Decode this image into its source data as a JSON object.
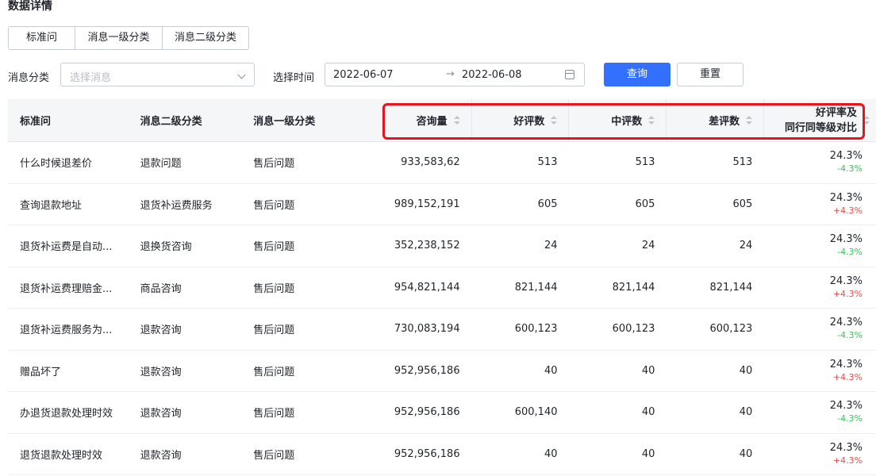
{
  "page": {
    "title": "数据详情"
  },
  "tabs": [
    {
      "label": "标准问"
    },
    {
      "label": "消息一级分类"
    },
    {
      "label": "消息二级分类"
    }
  ],
  "filters": {
    "category_label": "消息分类",
    "category_placeholder": "选择消息",
    "time_label": "选择时间",
    "date_start": "2022-06-07",
    "date_separator": "→",
    "date_end": "2022-06-08",
    "query_button": "查询",
    "reset_button": "重置"
  },
  "colors": {
    "primary": "#3370ff",
    "highlight": "#e8141b",
    "negative_delta": "#34c759",
    "positive_delta": "#f54a45"
  },
  "table": {
    "columns": {
      "standard_question": "标准问",
      "level2": "消息二级分类",
      "level1": "消息一级分类",
      "inquiries": "咨询量",
      "good": "好评数",
      "medium": "中评数",
      "bad": "差评数",
      "rate_line1": "好评率及",
      "rate_line2": "同行同等级对比"
    },
    "rows": [
      {
        "q": "什么时候退差价",
        "l2": "退款问题",
        "l1": "售后问题",
        "inq": "933,583,62",
        "good": "513",
        "medium": "513",
        "bad": "513",
        "rate": "24.3%",
        "delta": "-4.3%",
        "delta_dir": "neg"
      },
      {
        "q": "查询退款地址",
        "l2": "退货补运费服务",
        "l1": "售后问题",
        "inq": "989,152,191",
        "good": "605",
        "medium": "605",
        "bad": "605",
        "rate": "24.3%",
        "delta": "+4.3%",
        "delta_dir": "pos"
      },
      {
        "q": "退货补运费是自动...",
        "l2": "退换货咨询",
        "l1": "售后问题",
        "inq": "352,238,152",
        "good": "24",
        "medium": "24",
        "bad": "24",
        "rate": "24.3%",
        "delta": "-4.3%",
        "delta_dir": "neg"
      },
      {
        "q": "退货补运费理赔金...",
        "l2": "商品咨询",
        "l1": "售后问题",
        "inq": "954,821,144",
        "good": "821,144",
        "medium": "821,144",
        "bad": "821,144",
        "rate": "24.3%",
        "delta": "+4.3%",
        "delta_dir": "pos"
      },
      {
        "q": "退货补运费服务为...",
        "l2": "退款咨询",
        "l1": "售后问题",
        "inq": "730,083,194",
        "good": "600,123",
        "medium": "600,123",
        "bad": "600,123",
        "rate": "24.3%",
        "delta": "-4.3%",
        "delta_dir": "neg"
      },
      {
        "q": "赠品坏了",
        "l2": "退款咨询",
        "l1": "售后问题",
        "inq": "952,956,186",
        "good": "40",
        "medium": "40",
        "bad": "40",
        "rate": "24.3%",
        "delta": "+4.3%",
        "delta_dir": "pos"
      },
      {
        "q": "办退货退款处理时效",
        "l2": "退款咨询",
        "l1": "售后问题",
        "inq": "952,956,186",
        "good": "600,140",
        "medium": "40",
        "bad": "40",
        "rate": "24.3%",
        "delta": "-4.3%",
        "delta_dir": "neg"
      },
      {
        "q": "退货退款处理时效",
        "l2": "退款咨询",
        "l1": "售后问题",
        "inq": "952,956,186",
        "good": "40",
        "medium": "40",
        "bad": "40",
        "rate": "24.3%",
        "delta": "+4.3%",
        "delta_dir": "pos"
      }
    ]
  }
}
